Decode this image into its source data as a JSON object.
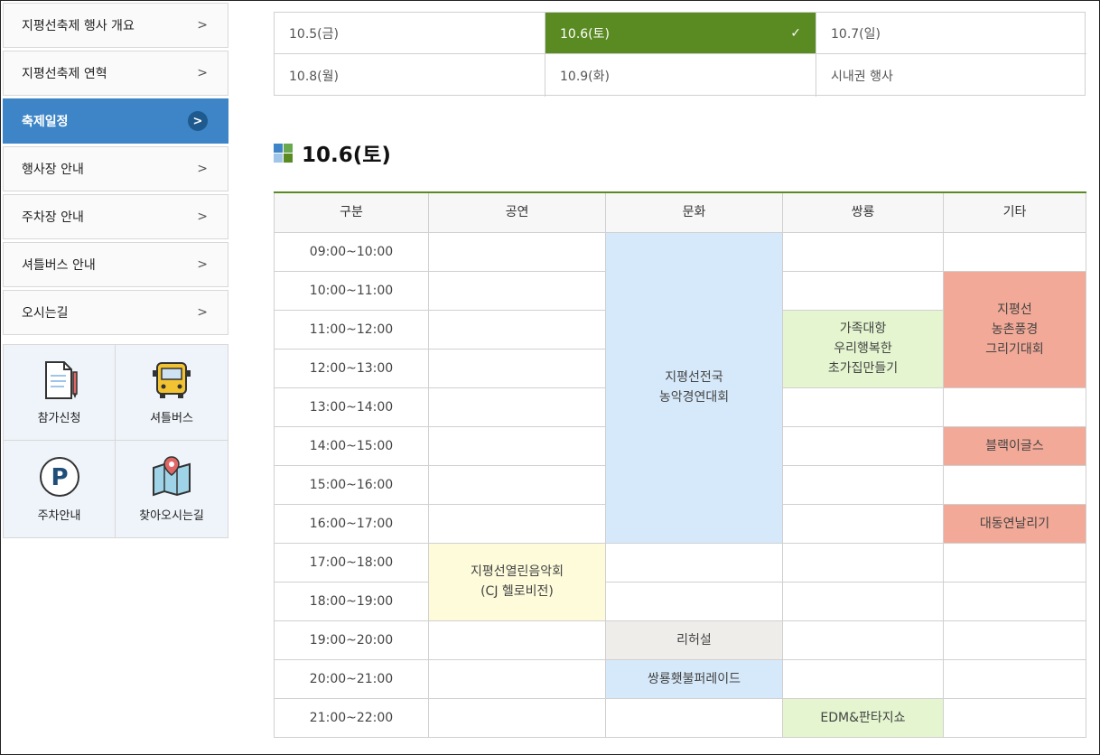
{
  "sidebar": {
    "items": [
      {
        "label": "지평선축제 행사 개요",
        "active": false
      },
      {
        "label": "지평선축제 연혁",
        "active": false
      },
      {
        "label": "축제일정",
        "active": true
      },
      {
        "label": "행사장 안내",
        "active": false
      },
      {
        "label": "주차장 안내",
        "active": false
      },
      {
        "label": "셔틀버스 안내",
        "active": false
      },
      {
        "label": "오시는길",
        "active": false
      }
    ],
    "quick_links": [
      {
        "label": "참가신청",
        "icon": "application-form-icon"
      },
      {
        "label": "셔틀버스",
        "icon": "bus-icon"
      },
      {
        "label": "주차안내",
        "icon": "parking-icon"
      },
      {
        "label": "찾아오시는길",
        "icon": "map-pin-icon"
      }
    ]
  },
  "date_tabs": [
    {
      "label": "10.5(금)",
      "active": false
    },
    {
      "label": "10.6(토)",
      "active": true
    },
    {
      "label": "10.7(일)",
      "active": false
    },
    {
      "label": "10.8(월)",
      "active": false
    },
    {
      "label": "10.9(화)",
      "active": false
    },
    {
      "label": "시내권 행사",
      "active": false
    }
  ],
  "heading": "10.6(토)",
  "table": {
    "headers": [
      "구분",
      "공연",
      "문화",
      "쌍룡",
      "기타"
    ],
    "times": [
      "09:00~10:00",
      "10:00~11:00",
      "11:00~12:00",
      "12:00~13:00",
      "13:00~14:00",
      "14:00~15:00",
      "15:00~16:00",
      "16:00~17:00",
      "17:00~18:00",
      "18:00~19:00",
      "19:00~20:00",
      "20:00~21:00",
      "21:00~22:00"
    ],
    "events": {
      "culture_main": [
        "지평선전국",
        "농악경연대회"
      ],
      "ssang_family": [
        "가족대항",
        "우리행복한",
        "초가집만들기"
      ],
      "etc_drawing": [
        "지평선",
        "농촌풍경",
        "그리기대회"
      ],
      "etc_blackeagles": "블랙이글스",
      "etc_kite": "대동연날리기",
      "perf_concert": [
        "지평선열린음악회",
        "(CJ 헬로비전)"
      ],
      "culture_rehearsal": "리허설",
      "culture_parade": "쌍룡횃불퍼레이드",
      "ssang_edm": "EDM&판타지쇼"
    }
  },
  "colors": {
    "active_menu": "#3d85c6",
    "active_tab": "#5a8a22",
    "culture": "#d6e9fa",
    "ssangryong": "#e4f5cf",
    "etc": "#f2a997",
    "performance": "#fdfbda",
    "rehearsal": "#efedea"
  }
}
